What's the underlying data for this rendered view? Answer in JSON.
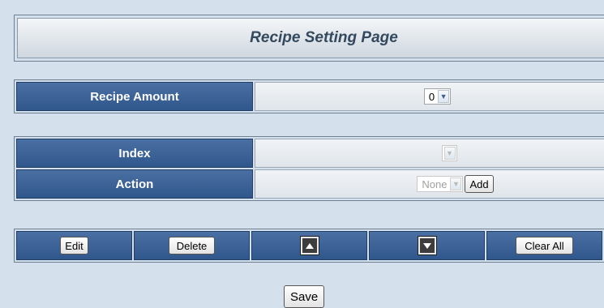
{
  "page": {
    "title": "Recipe Setting Page"
  },
  "recipe_amount": {
    "label": "Recipe Amount",
    "selected": "0"
  },
  "index": {
    "label": "Index",
    "selected": ""
  },
  "action": {
    "label": "Action",
    "selected": "None",
    "add_label": "Add"
  },
  "toolbar": {
    "edit_label": "Edit",
    "delete_label": "Delete",
    "up_icon": "arrow-up-icon",
    "down_icon": "arrow-down-icon",
    "clear_all_label": "Clear All"
  },
  "save_label": "Save",
  "colors": {
    "background": "#d4e1ed",
    "header_blue": "#30578c",
    "title_text": "#34495e"
  }
}
